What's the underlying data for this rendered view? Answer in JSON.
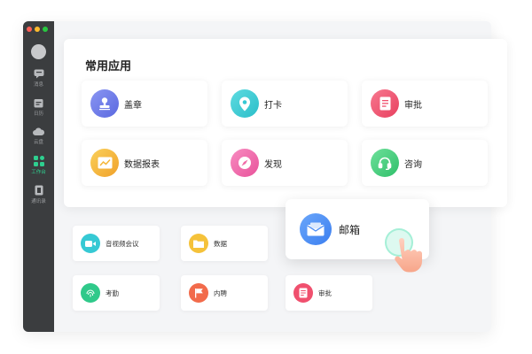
{
  "colors": {
    "sidebar_bg": "#3b3d3f",
    "active_green": "#2ecf8f",
    "traffic": [
      "#ff5f57",
      "#febc2e",
      "#28c840"
    ]
  },
  "sidebar": {
    "items": [
      {
        "label": "消息",
        "icon": "chat-icon"
      },
      {
        "label": "日历",
        "icon": "calendar-icon"
      },
      {
        "label": "云盘",
        "icon": "cloud-icon"
      },
      {
        "label": "工作台",
        "icon": "grid-icon",
        "active": true
      },
      {
        "label": "通讯录",
        "icon": "contacts-icon"
      }
    ]
  },
  "common_apps": {
    "title": "常用应用",
    "tiles": [
      {
        "label": "盖章",
        "icon": "stamp-icon",
        "color": "#6a79e8"
      },
      {
        "label": "打卡",
        "icon": "location-pin-icon",
        "color": "#36c9d4"
      },
      {
        "label": "审批",
        "icon": "document-icon",
        "color": "#f0506e"
      },
      {
        "label": "数据报表",
        "icon": "chart-icon",
        "color": "#f5b638"
      },
      {
        "label": "发现",
        "icon": "compass-icon",
        "color": "#f06aa8"
      },
      {
        "label": "咨询",
        "icon": "headset-icon",
        "color": "#3ccf7a"
      }
    ]
  },
  "more_apps": [
    {
      "label": "音视频会议",
      "icon": "video-icon",
      "color": "#36c9d4"
    },
    {
      "label": "数据",
      "icon": "folder-icon",
      "color": "#f5c23a"
    },
    {
      "label": "考勤",
      "icon": "fingerprint-icon",
      "color": "#2fc98a"
    },
    {
      "label": "内聘",
      "icon": "flag-icon",
      "color": "#f26b4b"
    },
    {
      "label": "审批",
      "icon": "document-icon",
      "color": "#f0506e"
    }
  ],
  "mail": {
    "label": "邮箱",
    "icon": "mail-icon",
    "color": "#4a8cf5"
  },
  "pointer": {
    "icon": "hand-pointer-icon"
  }
}
